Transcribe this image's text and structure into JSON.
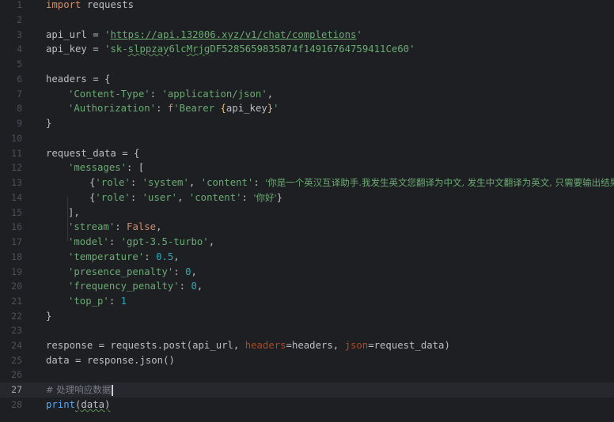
{
  "editor": {
    "language": "python",
    "current_line": 27,
    "lines": [
      {
        "n": "1"
      },
      {
        "n": "2"
      },
      {
        "n": "3"
      },
      {
        "n": "4"
      },
      {
        "n": "5"
      },
      {
        "n": "6"
      },
      {
        "n": "7"
      },
      {
        "n": "8"
      },
      {
        "n": "9"
      },
      {
        "n": "10"
      },
      {
        "n": "11"
      },
      {
        "n": "12"
      },
      {
        "n": "13"
      },
      {
        "n": "14"
      },
      {
        "n": "15"
      },
      {
        "n": "16"
      },
      {
        "n": "17"
      },
      {
        "n": "18"
      },
      {
        "n": "19"
      },
      {
        "n": "20"
      },
      {
        "n": "21"
      },
      {
        "n": "22"
      },
      {
        "n": "23"
      },
      {
        "n": "24"
      },
      {
        "n": "25"
      },
      {
        "n": "26"
      },
      {
        "n": "27"
      },
      {
        "n": "28"
      }
    ],
    "tok": {
      "import": "import",
      "requests_module": " requests",
      "api_url_var": "api_url = ",
      "api_url_value": "https://api.132006.xyz/v1/chat/completions",
      "quote": "'",
      "api_key_var": "api_key = ",
      "api_key_prefix": "sk-",
      "api_key_squiggle1": "slppzay",
      "api_key_mid": "6lc",
      "api_key_squiggle2": "Mrjg",
      "api_key_rest": "DF5285659835874f14916764759411Ce60",
      "headers_open": "headers = {",
      "content_type_key": "'Content-Type'",
      "content_type_val": "'application/json'",
      "authorization_key": "'Authorization'",
      "f_prefix": "f",
      "bearer_text": "'Bearer ",
      "api_key_ref": "api_key",
      "close_quote": "'",
      "brace_open": "{",
      "brace_close": "}",
      "colon_space": ": ",
      "comma": ",",
      "comma_space": ", ",
      "request_data_open": "request_data = {",
      "messages_key": "'messages'",
      "list_open": ": [",
      "role_key": "'role'",
      "system_val": "'system'",
      "content_key": "'content'",
      "system_prompt": "'你是一个英汉互译助手.我发生英文您翻译为中文, 发生中文翻译为英文, 只需要输出结果。'",
      "user_val": "'user'",
      "user_content": "'你好'",
      "list_close": "],",
      "stream_key": "'stream'",
      "false_kw": "False",
      "model_key": "'model'",
      "model_val": "'gpt-3.5-turbo'",
      "temperature_key": "'temperature'",
      "temperature_val": "0.5",
      "presence_key": "'presence_penalty'",
      "frequency_key": "'frequency_penalty'",
      "zero": "0",
      "top_p_key": "'top_p'",
      "one": "1",
      "response_prefix": "response = requests.post(api_url, ",
      "headers_param": "headers",
      "headers_arg": "=headers, ",
      "json_param": "json",
      "json_arg": "=request_data)",
      "data_line": "data = response.json()",
      "comment": "# 处理响应数据",
      "print_fn": "print",
      "print_args": "(data)"
    }
  }
}
